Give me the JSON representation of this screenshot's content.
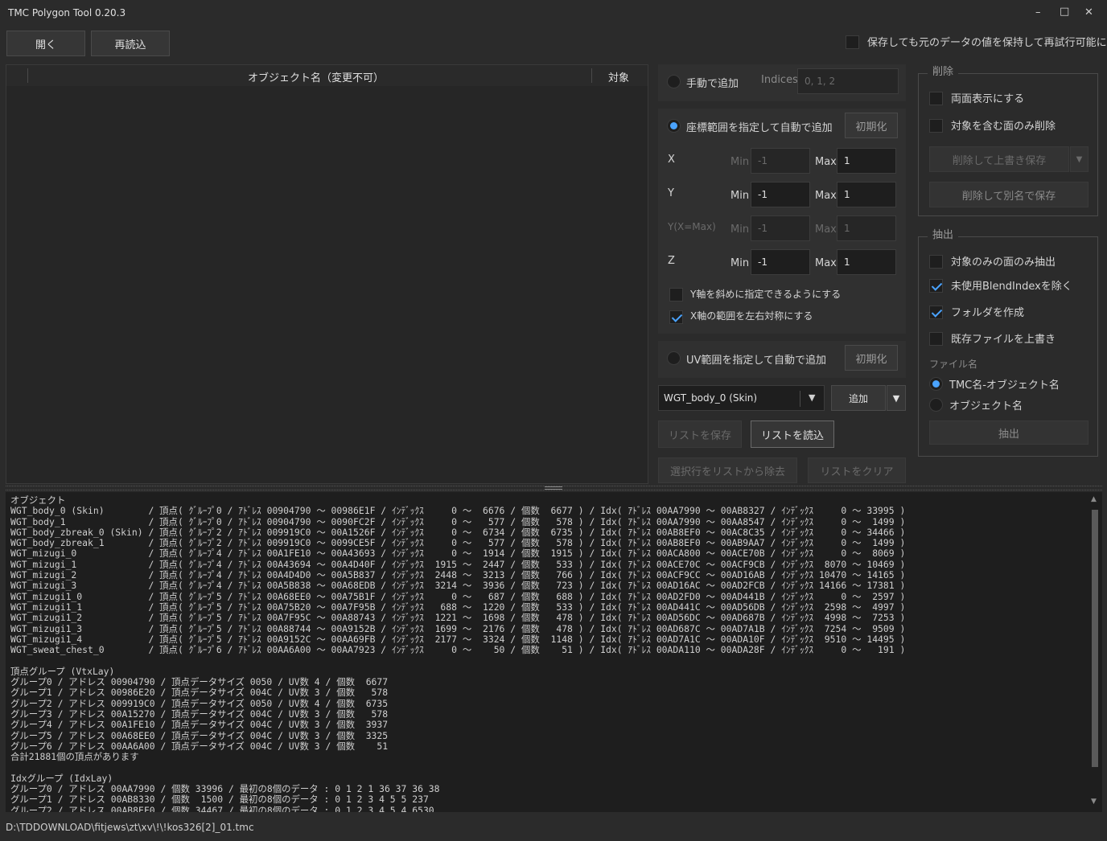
{
  "window": {
    "title": "TMC Polygon Tool 0.20.3",
    "min": "–",
    "max": "□",
    "close": "✕"
  },
  "toolbar": {
    "open": "開く",
    "reload": "再読込",
    "keep_label": "保存しても元のデータの値を保持して再試行可能にする"
  },
  "table": {
    "col_name": "オブジェクト名（変更不可）",
    "col_target": "対象"
  },
  "manual": {
    "label": "手動で追加",
    "indices_label": "Indices",
    "indices_value": "0, 1, 2"
  },
  "coord": {
    "label": "座標範囲を指定して自動で追加",
    "reset": "初期化",
    "rows": [
      {
        "axis": "X",
        "min_label": "Min",
        "min": "-1",
        "max_label": "Max",
        "max": "1"
      },
      {
        "axis": "Y",
        "min_label": "Min",
        "min": "-1",
        "max_label": "Max",
        "max": "1"
      },
      {
        "axis": "Y(X=Max)",
        "min_label": "Min",
        "min": "-1",
        "max_label": "Max",
        "max": "1"
      },
      {
        "axis": "Z",
        "min_label": "Min",
        "min": "-1",
        "max_label": "Max",
        "max": "1"
      }
    ],
    "diag_label": "Y軸を斜めに指定できるようにする",
    "sym_label": "X軸の範囲を左右対称にする"
  },
  "uv": {
    "label": "UV範囲を指定して自動で追加",
    "reset": "初期化"
  },
  "object_select": {
    "value": "WGT_body_0 (Skin)"
  },
  "add": {
    "label": "追加"
  },
  "list": {
    "save": "リストを保存",
    "load": "リストを読込",
    "remove": "選択行をリストから除去",
    "clear": "リストをクリア"
  },
  "delete": {
    "title": "削除",
    "double_side": "両面表示にする",
    "only_faces": "対象を含む面のみ削除",
    "overwrite": "削除して上書き保存",
    "save_as": "削除して別名で保存"
  },
  "extract": {
    "title": "抽出",
    "only_target": "対象のみの面のみ抽出",
    "exclude_unused": "未使用BlendIndexを除く",
    "make_folder": "フォルダを作成",
    "overwrite": "既存ファイルを上書き",
    "filename_label": "ファイル名",
    "opt1": "TMC名-オブジェクト名",
    "opt2": "オブジェクト名",
    "button": "抽出"
  },
  "log": {
    "lines": [
      "オブジェクト",
      "WGT_body_0 (Skin)        / 頂点( ｸﾞﾙｰﾌﾟ0 / ｱﾄﾞﾚｽ 00904790 ～ 00986E1F / ｲﾝﾃﾞｯｸｽ     0 ～  6676 / 個数  6677 ) / Idx( ｱﾄﾞﾚｽ 00AA7990 ～ 00AB8327 / ｲﾝﾃﾞｯｸｽ     0 ～ 33995 )",
      "WGT_body_1               / 頂点( ｸﾞﾙｰﾌﾟ0 / ｱﾄﾞﾚｽ 00904790 ～ 0090FC2F / ｲﾝﾃﾞｯｸｽ     0 ～   577 / 個数   578 ) / Idx( ｱﾄﾞﾚｽ 00AA7990 ～ 00AA8547 / ｲﾝﾃﾞｯｸｽ     0 ～  1499 )",
      "WGT_body_zbreak_0 (Skin) / 頂点( ｸﾞﾙｰﾌﾟ2 / ｱﾄﾞﾚｽ 009919C0 ～ 00A1526F / ｲﾝﾃﾞｯｸｽ     0 ～  6734 / 個数  6735 ) / Idx( ｱﾄﾞﾚｽ 00AB8EF0 ～ 00AC8C35 / ｲﾝﾃﾞｯｸｽ     0 ～ 34466 )",
      "WGT_body_zbreak_1        / 頂点( ｸﾞﾙｰﾌﾟ2 / ｱﾄﾞﾚｽ 009919C0 ～ 0099CE5F / ｲﾝﾃﾞｯｸｽ     0 ～   577 / 個数   578 ) / Idx( ｱﾄﾞﾚｽ 00AB8EF0 ～ 00AB9AA7 / ｲﾝﾃﾞｯｸｽ     0 ～  1499 )",
      "WGT_mizugi_0             / 頂点( ｸﾞﾙｰﾌﾟ4 / ｱﾄﾞﾚｽ 00A1FE10 ～ 00A43693 / ｲﾝﾃﾞｯｸｽ     0 ～  1914 / 個数  1915 ) / Idx( ｱﾄﾞﾚｽ 00ACA800 ～ 00ACE70B / ｲﾝﾃﾞｯｸｽ     0 ～  8069 )",
      "WGT_mizugi_1             / 頂点( ｸﾞﾙｰﾌﾟ4 / ｱﾄﾞﾚｽ 00A43694 ～ 00A4D40F / ｲﾝﾃﾞｯｸｽ  1915 ～  2447 / 個数   533 ) / Idx( ｱﾄﾞﾚｽ 00ACE70C ～ 00ACF9CB / ｲﾝﾃﾞｯｸｽ  8070 ～ 10469 )",
      "WGT_mizugi_2             / 頂点( ｸﾞﾙｰﾌﾟ4 / ｱﾄﾞﾚｽ 00A4D4D0 ～ 00A5B837 / ｲﾝﾃﾞｯｸｽ  2448 ～  3213 / 個数   766 ) / Idx( ｱﾄﾞﾚｽ 00ACF9CC ～ 00AD16AB / ｲﾝﾃﾞｯｸｽ 10470 ～ 14165 )",
      "WGT_mizugi_3             / 頂点( ｸﾞﾙｰﾌﾟ4 / ｱﾄﾞﾚｽ 00A5B838 ～ 00A68EDB / ｲﾝﾃﾞｯｸｽ  3214 ～  3936 / 個数   723 ) / Idx( ｱﾄﾞﾚｽ 00AD16AC ～ 00AD2FCB / ｲﾝﾃﾞｯｸｽ 14166 ～ 17381 )",
      "WGT_mizugi1_0            / 頂点( ｸﾞﾙｰﾌﾟ5 / ｱﾄﾞﾚｽ 00A68EE0 ～ 00A75B1F / ｲﾝﾃﾞｯｸｽ     0 ～   687 / 個数   688 ) / Idx( ｱﾄﾞﾚｽ 00AD2FD0 ～ 00AD441B / ｲﾝﾃﾞｯｸｽ     0 ～  2597 )",
      "WGT_mizugi1_1            / 頂点( ｸﾞﾙｰﾌﾟ5 / ｱﾄﾞﾚｽ 00A75B20 ～ 00A7F95B / ｲﾝﾃﾞｯｸｽ   688 ～  1220 / 個数   533 ) / Idx( ｱﾄﾞﾚｽ 00AD441C ～ 00AD56DB / ｲﾝﾃﾞｯｸｽ  2598 ～  4997 )",
      "WGT_mizugi1_2            / 頂点( ｸﾞﾙｰﾌﾟ5 / ｱﾄﾞﾚｽ 00A7F95C ～ 00A88743 / ｲﾝﾃﾞｯｸｽ  1221 ～  1698 / 個数   478 ) / Idx( ｱﾄﾞﾚｽ 00AD56DC ～ 00AD687B / ｲﾝﾃﾞｯｸｽ  4998 ～  7253 )",
      "WGT_mizugi1_3            / 頂点( ｸﾞﾙｰﾌﾟ5 / ｱﾄﾞﾚｽ 00A88744 ～ 00A9152B / ｲﾝﾃﾞｯｸｽ  1699 ～  2176 / 個数   478 ) / Idx( ｱﾄﾞﾚｽ 00AD687C ～ 00AD7A1B / ｲﾝﾃﾞｯｸｽ  7254 ～  9509 )",
      "WGT_mizugi1_4            / 頂点( ｸﾞﾙｰﾌﾟ5 / ｱﾄﾞﾚｽ 00A9152C ～ 00AA69FB / ｲﾝﾃﾞｯｸｽ  2177 ～  3324 / 個数  1148 ) / Idx( ｱﾄﾞﾚｽ 00AD7A1C ～ 00ADA10F / ｲﾝﾃﾞｯｸｽ  9510 ～ 14495 )",
      "WGT_sweat_chest_0        / 頂点( ｸﾞﾙｰﾌﾟ6 / ｱﾄﾞﾚｽ 00AA6A00 ～ 00AA7923 / ｲﾝﾃﾞｯｸｽ     0 ～    50 / 個数    51 ) / Idx( ｱﾄﾞﾚｽ 00ADA110 ～ 00ADA28F / ｲﾝﾃﾞｯｸｽ     0 ～   191 )",
      "",
      "頂点グループ (VtxLay)",
      "グループ0 / アドレス 00904790 / 頂点データサイズ 0050 / UV数 4 / 個数  6677",
      "グループ1 / アドレス 00986E20 / 頂点データサイズ 004C / UV数 3 / 個数   578",
      "グループ2 / アドレス 009919C0 / 頂点データサイズ 0050 / UV数 4 / 個数  6735",
      "グループ3 / アドレス 00A15270 / 頂点データサイズ 004C / UV数 3 / 個数   578",
      "グループ4 / アドレス 00A1FE10 / 頂点データサイズ 004C / UV数 3 / 個数  3937",
      "グループ5 / アドレス 00A68EE0 / 頂点データサイズ 004C / UV数 3 / 個数  3325",
      "グループ6 / アドレス 00AA6A00 / 頂点データサイズ 004C / UV数 3 / 個数    51",
      "合計21881個の頂点があります",
      "",
      "Idxグループ (IdxLay)",
      "グループ0 / アドレス 00AA7990 / 個数 33996 / 最初の8個のデータ : 0 1 2 1 36 37 36 38",
      "グループ1 / アドレス 00AB8330 / 個数  1500 / 最初の8個のデータ : 0 1 2 3 4 5 5 237",
      "グループ2 / アドレス 00AB8EF0 / 個数 34467 / 最初の8個のデータ : 0 1 2 3 4 5 4 6530"
    ]
  },
  "status": {
    "path": "D:\\TDDOWNLOAD\\fitjews\\zt\\xv\\!\\!kos326[2]_01.tmc"
  },
  "colors": {
    "accent": "#4aa3ff",
    "background": "#2b2b2b",
    "panel": "#303030",
    "text": "#d4d4d4"
  }
}
